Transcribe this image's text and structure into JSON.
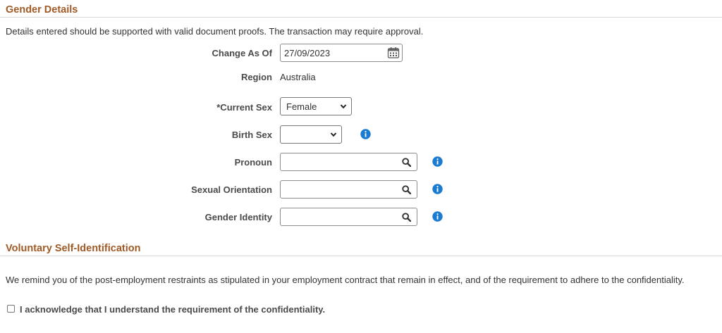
{
  "gender_section": {
    "title": "Gender Details",
    "note": "Details entered should be supported with valid document proofs. The transaction may require approval."
  },
  "fields": {
    "change_as_of": {
      "label": "Change As Of",
      "value": "27/09/2023",
      "icon": "calendar-icon"
    },
    "region": {
      "label": "Region",
      "value": "Australia"
    },
    "current_sex": {
      "label": "*Current Sex",
      "value": "Female"
    },
    "birth_sex": {
      "label": "Birth Sex",
      "value": "",
      "info_icon": "info-icon"
    },
    "pronoun": {
      "label": "Pronoun",
      "value": "",
      "icon": "search-icon",
      "info_icon": "info-icon"
    },
    "sexual_orientation": {
      "label": "Sexual Orientation",
      "value": "",
      "icon": "search-icon",
      "info_icon": "info-icon"
    },
    "gender_identity": {
      "label": "Gender Identity",
      "value": "",
      "icon": "search-icon",
      "info_icon": "info-icon"
    }
  },
  "voluntary_section": {
    "title": "Voluntary Self-Identification",
    "reminder": "We remind you of the post-employment restraints as stipulated in your employment contract that remain in effect, and of the requirement to adhere to the confidentiality.",
    "acknowledge_label": "I acknowledge that I understand the requirement of the confidentiality.",
    "acknowledged": false
  },
  "colors": {
    "section_title": "#a05a25",
    "info_icon": "#1a7bd0",
    "label_text": "#4a4a4a"
  }
}
